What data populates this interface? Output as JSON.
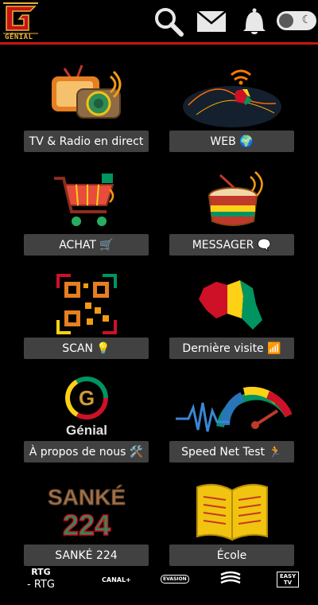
{
  "header": {
    "logo_text": "GÉNIAL",
    "icons": [
      "search-icon",
      "mail-icon",
      "bell-icon",
      "dark-mode-toggle"
    ]
  },
  "tiles": [
    {
      "label": "TV & Radio en direct",
      "icon": "tv-radio-icon"
    },
    {
      "label": "WEB 🌍",
      "icon": "web-globe-icon"
    },
    {
      "label": "ACHAT 🛒",
      "icon": "shopping-cart-icon"
    },
    {
      "label": "MESSAGER 🗨️",
      "icon": "drum-icon"
    },
    {
      "label": "SCAN 💡",
      "icon": "qr-code-icon"
    },
    {
      "label": "Dernière visite 📶",
      "icon": "guinea-map-icon"
    },
    {
      "label": "À propos de nous 🛠️",
      "icon": "genial-logo-icon"
    },
    {
      "label": "Speed Net Test 🏃",
      "icon": "speedometer-icon"
    },
    {
      "label": "SANKÉ 224",
      "icon": "sanke-logo-icon"
    },
    {
      "label": "École",
      "icon": "open-book-icon"
    }
  ],
  "tile_art_text": {
    "genial_word": "Génial",
    "sanke_line1": "SANKÉ",
    "sanke_line2": "224"
  },
  "bottom_channels": [
    {
      "logo": "RTG",
      "name": "- RTG"
    },
    {
      "logo": "CANAL+",
      "name": ""
    },
    {
      "logo": "EVASION",
      "name": ""
    },
    {
      "logo": "~",
      "name": ""
    },
    {
      "logo": "EASY TV",
      "name": ""
    }
  ],
  "colors": {
    "background": "#000000",
    "header_accent": "#c81414",
    "tile_label_bg": "#414141",
    "guinea_red": "#ce1126",
    "guinea_yellow": "#fcd116",
    "guinea_green": "#009460"
  }
}
